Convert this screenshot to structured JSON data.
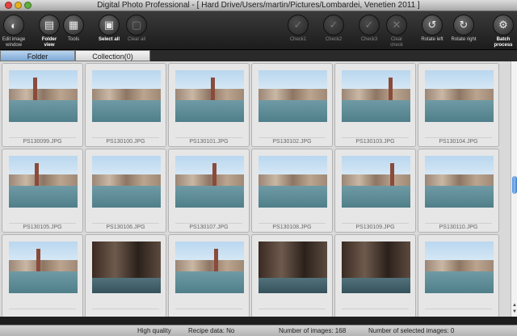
{
  "window": {
    "title": "Digital Photo Professional - [ Hard Drive/Users/martin/Pictures/Lombardei, Venetien 2011 ]"
  },
  "toolbar": {
    "buttons": [
      {
        "label": "Edit image\nwindow",
        "icon": "edit-window-icon",
        "glyph": "◐"
      },
      {
        "label": "Folder\nview",
        "icon": "folder-view-icon",
        "glyph": "▤"
      },
      {
        "label": "Tools",
        "icon": "tools-icon",
        "glyph": "▦"
      },
      {
        "label": "Select all",
        "icon": "select-all-icon",
        "glyph": "▣"
      },
      {
        "label": "Clear all",
        "icon": "clear-all-icon",
        "glyph": "▢"
      },
      {
        "label": "Check1",
        "icon": "check1-icon",
        "glyph": "✓"
      },
      {
        "label": "Check2",
        "icon": "check2-icon",
        "glyph": "✓"
      },
      {
        "label": "Check3",
        "icon": "check3-icon",
        "glyph": "✓"
      },
      {
        "label": "Clear\ncheck",
        "icon": "clear-check-icon",
        "glyph": "✕"
      },
      {
        "label": "Rotate left",
        "icon": "rotate-left-icon",
        "glyph": "↺"
      },
      {
        "label": "Rotate right",
        "icon": "rotate-right-icon",
        "glyph": "↻"
      },
      {
        "label": "Batch\nprocess",
        "icon": "batch-process-icon",
        "glyph": "⚙"
      }
    ]
  },
  "tabs": {
    "folder": "Folder",
    "collection": "Collection(0)"
  },
  "images": [
    {
      "name": "PS130099.JPG",
      "style": "light"
    },
    {
      "name": "PS130100.JPG",
      "style": "light"
    },
    {
      "name": "PS130101.JPG",
      "style": "light"
    },
    {
      "name": "PS130102.JPG",
      "style": "light"
    },
    {
      "name": "PS130103.JPG",
      "style": "light"
    },
    {
      "name": "PS130104.JPG",
      "style": "light"
    },
    {
      "name": "PS130105.JPG",
      "style": "light"
    },
    {
      "name": "PS130106.JPG",
      "style": "light"
    },
    {
      "name": "PS130107.JPG",
      "style": "light"
    },
    {
      "name": "PS130108.JPG",
      "style": "light"
    },
    {
      "name": "PS130109.JPG",
      "style": "light"
    },
    {
      "name": "PS130110.JPG",
      "style": "light"
    },
    {
      "name": "",
      "style": "light"
    },
    {
      "name": "",
      "style": "dark"
    },
    {
      "name": "",
      "style": "light"
    },
    {
      "name": "",
      "style": "dark"
    },
    {
      "name": "",
      "style": "dark"
    },
    {
      "name": "",
      "style": "light"
    }
  ],
  "status": {
    "quality": "High quality",
    "recipe": "Recipe data: No",
    "num_images": "Number of images: 168",
    "num_selected": "Number of selected images: 0"
  },
  "colors": {
    "tab_active": "#7fa9d6",
    "scroll_thumb": "#4a8fe0"
  }
}
